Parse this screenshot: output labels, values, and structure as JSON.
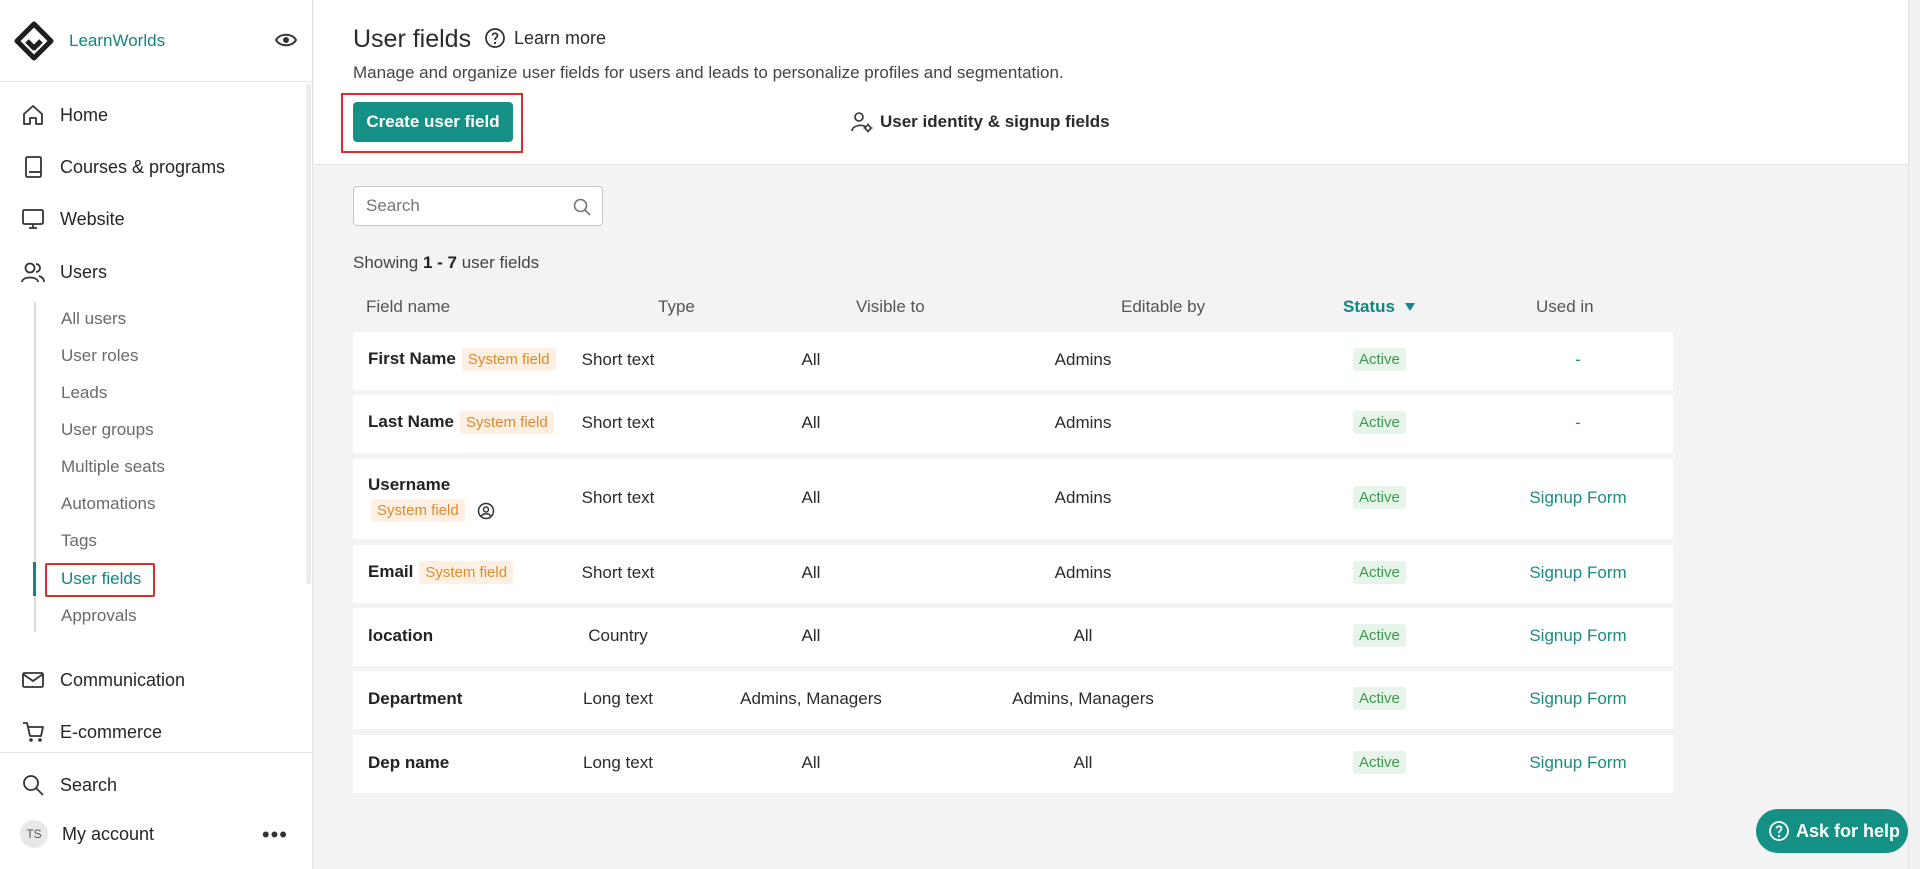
{
  "brand": {
    "name": "LearnWorlds"
  },
  "nav": {
    "home": "Home",
    "courses": "Courses & programs",
    "website": "Website",
    "users": "Users",
    "communication": "Communication",
    "ecommerce": "E-commerce",
    "search": "Search",
    "account": "My account",
    "avatar_initials": "TS",
    "users_sub": [
      "All users",
      "User roles",
      "Leads",
      "User groups",
      "Multiple seats",
      "Automations",
      "Tags",
      "User fields",
      "Approvals"
    ]
  },
  "header": {
    "title": "User fields",
    "learn_more": "Learn more",
    "description": "Manage and organize user fields for users and leads to personalize profiles and segmentation.",
    "create_label": "Create user field",
    "identity_label": "User identity & signup fields"
  },
  "search": {
    "placeholder": "Search"
  },
  "showing": {
    "prefix": "Showing ",
    "range": "1 - 7",
    "suffix": " user fields"
  },
  "table": {
    "columns": [
      "Field name",
      "Type",
      "Visible to",
      "Editable by",
      "Status",
      "Used in"
    ],
    "rows": [
      {
        "name": "First Name",
        "tag": "System field",
        "type": "Short text",
        "visible": "All",
        "editable": "Admins",
        "status": "Active",
        "used": "-"
      },
      {
        "name": "Last Name",
        "tag": "System field",
        "type": "Short text",
        "visible": "All",
        "editable": "Admins",
        "status": "Active",
        "used": "-"
      },
      {
        "name": "Username",
        "tag": "System field",
        "type": "Short text",
        "visible": "All",
        "editable": "Admins",
        "status": "Active",
        "used": "Signup Form"
      },
      {
        "name": "Email",
        "tag": "System field",
        "type": "Short text",
        "visible": "All",
        "editable": "Admins",
        "status": "Active",
        "used": "Signup Form"
      },
      {
        "name": "location",
        "tag": "",
        "type": "Country",
        "visible": "All",
        "editable": "All",
        "status": "Active",
        "used": "Signup Form"
      },
      {
        "name": "Department",
        "tag": "",
        "type": "Long text",
        "visible": "Admins, Managers",
        "editable": "Admins, Managers",
        "status": "Active",
        "used": "Signup Form"
      },
      {
        "name": "Dep name",
        "tag": "",
        "type": "Long text",
        "visible": "All",
        "editable": "All",
        "status": "Active",
        "used": "Signup Form"
      }
    ]
  },
  "help": {
    "label": "Ask for help"
  },
  "colors": {
    "accent": "#149184",
    "link": "#1a8c84",
    "system_tag": "#e08a2e",
    "active_badge": "#3a9a52",
    "highlight": "#e02b2b"
  }
}
